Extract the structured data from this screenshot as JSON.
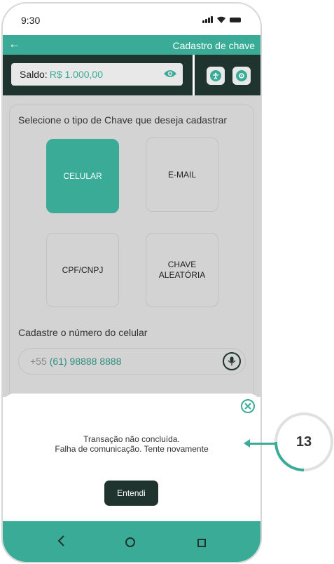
{
  "status_bar": {
    "time": "9:30",
    "icons": [
      "signal-icon",
      "wifi-icon",
      "battery-icon"
    ]
  },
  "header": {
    "title": "Cadastro de chave",
    "back_icon": "arrow-left-icon"
  },
  "balance": {
    "label": "Saldo:",
    "value": "R$ 1.000,00",
    "icon": "eye-icon"
  },
  "toolbar": {
    "buttons": [
      "accessibility-icon",
      "settings-icon"
    ]
  },
  "form": {
    "prompt": "Selecione o tipo de Chave que deseja cadastrar",
    "key_types": [
      {
        "label": "CELULAR",
        "selected": true
      },
      {
        "label": "E-MAIL",
        "selected": false
      },
      {
        "label": "CPF/CNPJ",
        "selected": false
      },
      {
        "label": "CHAVE ALEATÓRIA",
        "selected": false
      }
    ],
    "phone_label": "Cadastre o número do celular",
    "phone_country_code": "+55",
    "phone_number": "(61) 98888 8888",
    "mic_icon": "microphone-icon"
  },
  "dialog": {
    "message_line1": "Transação não concluída.",
    "message_line2": "Falha de comunicação. Tente novamente",
    "ok_label": "Entendi",
    "close_icon": "close-icon"
  },
  "nav": {
    "back_icon": "chevron-left-icon",
    "home_icon": "circle-home-icon",
    "recent_icon": "square-recents-icon"
  },
  "annotation": {
    "step": "13"
  },
  "colors": {
    "accent": "#3aab97",
    "dark": "#1f332f",
    "overlay": "#d3d3d3"
  }
}
